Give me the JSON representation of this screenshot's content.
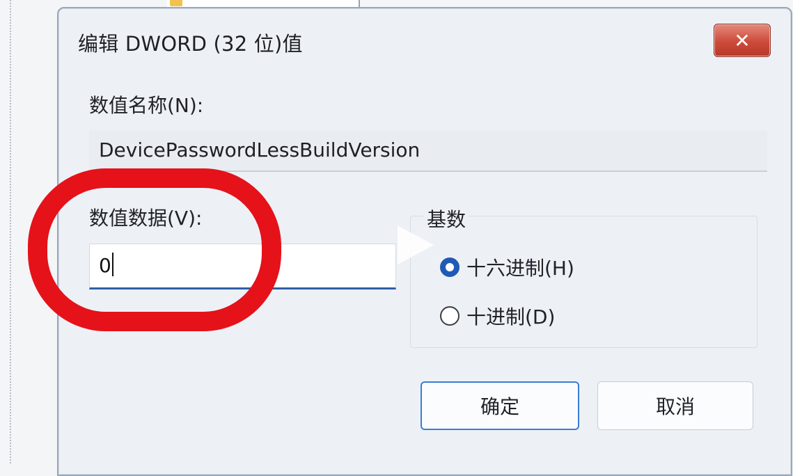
{
  "dialog": {
    "title": "编辑 DWORD (32 位)值",
    "close_label": "✕",
    "name_label": "数值名称(N):",
    "name_value": "DevicePasswordLessBuildVersion",
    "data_label": "数值数据(V):",
    "data_value": "0",
    "base": {
      "label": "基数",
      "options": [
        {
          "label": "十六进制(H)",
          "selected": true
        },
        {
          "label": "十进制(D)",
          "selected": false
        }
      ]
    },
    "ok_label": "确定",
    "cancel_label": "取消"
  },
  "colors": {
    "accent": "#1f5bb5",
    "close": "#cc4a39",
    "highlight": "#e5121a"
  }
}
